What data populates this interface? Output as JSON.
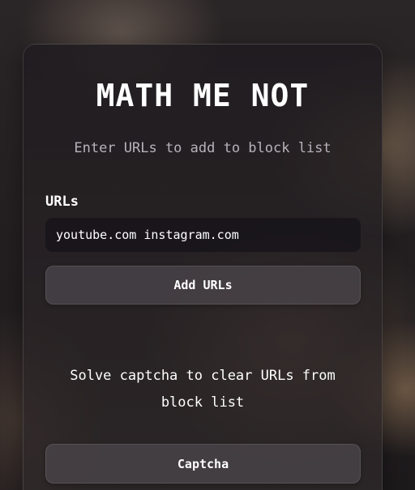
{
  "app": {
    "title": "MATH ME NOT",
    "subtitle": "Enter URLs to add to block list"
  },
  "form": {
    "urls_label": "URLs",
    "urls_value": "youtube.com instagram.com",
    "add_button_label": "Add URLs"
  },
  "captcha": {
    "prompt": "Solve captcha to clear URLs from block list",
    "button_label": "Captcha"
  },
  "colors": {
    "card_background": "#221e22",
    "text_primary": "#ffffff",
    "text_secondary": "#b8b2ba",
    "button_background": "#4e484e",
    "input_background": "#18141a"
  }
}
